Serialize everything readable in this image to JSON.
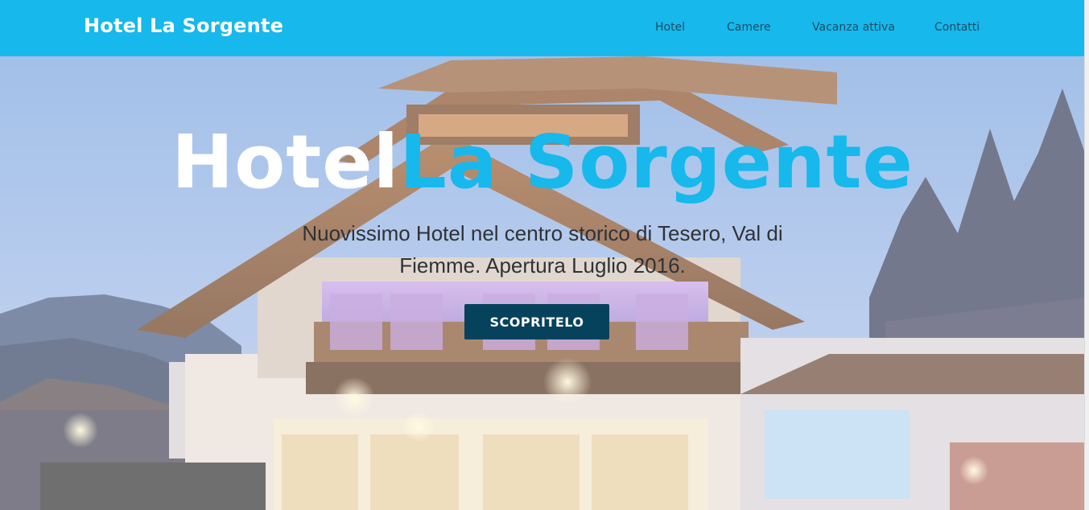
{
  "navbar": {
    "brand": "Hotel La Sorgente",
    "links": [
      {
        "label": "Hotel"
      },
      {
        "label": "Camere"
      },
      {
        "label": "Vacanza attiva"
      },
      {
        "label": "Contatti"
      }
    ]
  },
  "hero": {
    "title_part1": "Hotel",
    "title_part2": "La Sorgente",
    "subtitle": "Nuovissimo Hotel nel centro storico di Tesero, Val di Fiemme. Apertura Luglio 2016.",
    "cta_label": "SCOPRITELO"
  },
  "colors": {
    "accent": "#17b8ec",
    "button": "#06425c",
    "nav_text": "#1f4d63"
  }
}
